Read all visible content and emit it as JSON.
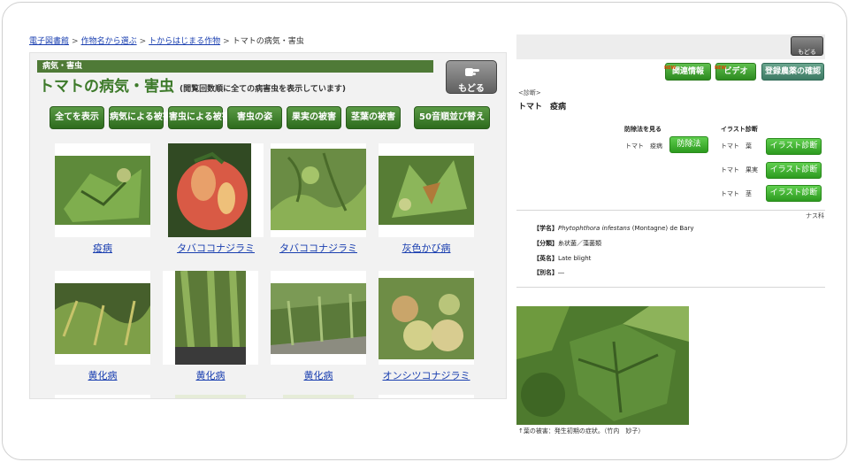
{
  "breadcrumb": {
    "links": [
      "電子図書館",
      "作物名から選ぶ",
      "トからはじまる作物"
    ],
    "current": "トマトの病気・害虫",
    "separator": ">"
  },
  "left_panel": {
    "category_label": "病気・害虫",
    "title": "トマトの病気・害虫",
    "subtitle": "(閲覧回数順に全ての病害虫を表示しています)",
    "back_button": "もどる",
    "filters": [
      "全てを表示",
      "病気による被害",
      "害虫による被害",
      "害虫の姿",
      "果実の被害",
      "茎葉の被害",
      "50音順並び替え"
    ],
    "items": [
      {
        "name": "疫病",
        "image": "diseased-leaf-icon"
      },
      {
        "name": "タバココナジラミ",
        "image": "tomato-fruit-icon"
      },
      {
        "name": "タバココナジラミ",
        "image": "plant-foliage-icon"
      },
      {
        "name": "灰色かび病",
        "image": "wilted-leaf-icon"
      },
      {
        "name": "黄化病",
        "image": "greenhouse-plants-icon"
      },
      {
        "name": "黄化病",
        "image": "greenhouse-plants-icon"
      },
      {
        "name": "黄化病",
        "image": "greenhouse-rows-icon"
      },
      {
        "name": "オンシツコナジラミ",
        "image": "green-tomatoes-icon"
      }
    ]
  },
  "right_panel": {
    "back_button": "もどる",
    "buttons": [
      {
        "label": "関連情報",
        "badge": "NEW"
      },
      {
        "label": "ビデオ",
        "badge": "NEW"
      },
      {
        "label": "登録農薬の確認",
        "badge": ""
      }
    ],
    "section_label": "<診断>",
    "heading": "トマト　疫病",
    "control_heading": "防除法を見る",
    "illust_heading": "イラスト診断",
    "control_row": {
      "crop": "トマト",
      "disease": "疫病",
      "button": "防除法"
    },
    "diagnosis_rows": [
      {
        "crop": "トマト",
        "part": "葉",
        "button": "イラスト診断"
      },
      {
        "crop": "トマト",
        "part": "果実",
        "button": "イラスト診断"
      },
      {
        "crop": "トマト",
        "part": "茎",
        "button": "イラスト診断"
      }
    ],
    "family": "ナス科",
    "details": [
      {
        "key": "【学名】",
        "value_italic": "Phytophthora infestans",
        "value": " (Montagne) de Bary"
      },
      {
        "key": "【分類】",
        "value_italic": "",
        "value": "糸状菌／藻菌類"
      },
      {
        "key": "【英名】",
        "value_italic": "",
        "value": "Late blight"
      },
      {
        "key": "【別名】",
        "value_italic": "",
        "value": "―"
      }
    ],
    "photo_caption": "↑葉の被害：発生初期の症状。（竹内　妙子）"
  },
  "colors": {
    "title_green": "#3d7a2a",
    "category_bar": "#4f7a37",
    "link_blue": "#1a3fb0",
    "button_green": "#2c8a1f"
  }
}
